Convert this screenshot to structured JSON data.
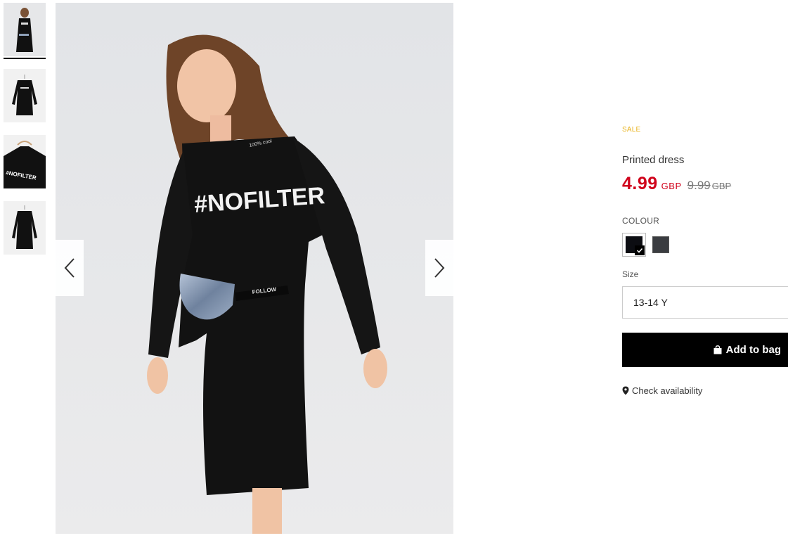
{
  "thumbnails": [
    {
      "icon": "model-photo-thumb",
      "active": true
    },
    {
      "icon": "dress-front-thumb",
      "active": false
    },
    {
      "icon": "dress-detail-thumb",
      "active": false
    },
    {
      "icon": "dress-back-thumb",
      "active": false
    }
  ],
  "main_image": {
    "print_text": "#NOFILTER",
    "belt_text": "FOLLOW",
    "collar_text": "100% cool",
    "prev_icon": "chevron-left-icon",
    "next_icon": "chevron-right-icon"
  },
  "product": {
    "badge": "SALE",
    "name": "Printed dress",
    "price_now": "4.99",
    "price_now_currency": "GBP",
    "price_old": "9.99",
    "price_old_currency": "GBP"
  },
  "colour": {
    "label": "COLOUR",
    "swatches": [
      {
        "color": "#0c0d12",
        "selected": true
      },
      {
        "color": "#3a3c40",
        "selected": false
      }
    ]
  },
  "size": {
    "label": "Size",
    "selected": "13-14 Y"
  },
  "add_to_bag": {
    "label": "Add to bag",
    "icon": "shopping-bag-icon"
  },
  "availability": {
    "label": "Check availability",
    "icon": "map-pin-icon"
  },
  "colors": {
    "sale": "#e8b21b",
    "price": "#d0021b",
    "button_bg": "#000000"
  }
}
